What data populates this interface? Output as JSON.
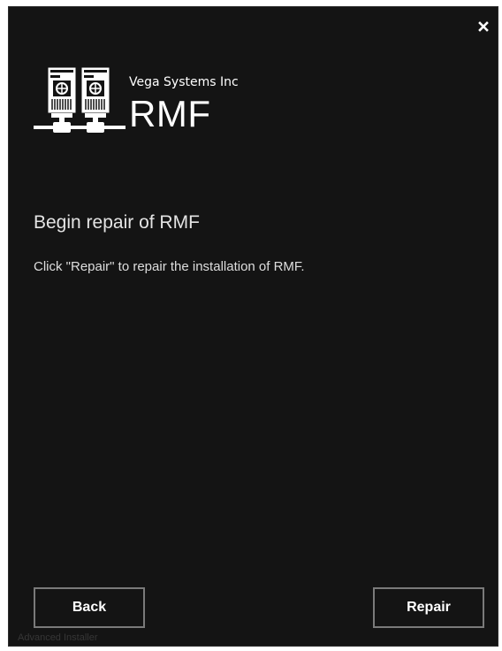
{
  "window": {
    "close_icon": "close-icon"
  },
  "brand": {
    "logo_icon": "servers-logo-icon",
    "company": "Vega Systems Inc",
    "product": "RMF"
  },
  "page": {
    "title": "Begin repair of RMF",
    "description": "Click \"Repair\" to repair the installation of RMF."
  },
  "buttons": {
    "back_label": "Back",
    "repair_label": "Repair"
  },
  "footer": {
    "brand": "Advanced Installer"
  },
  "colors": {
    "background": "#141414",
    "text": "#f0f0f0",
    "button_border": "#7a7a7a",
    "footer_text": "#363636"
  }
}
